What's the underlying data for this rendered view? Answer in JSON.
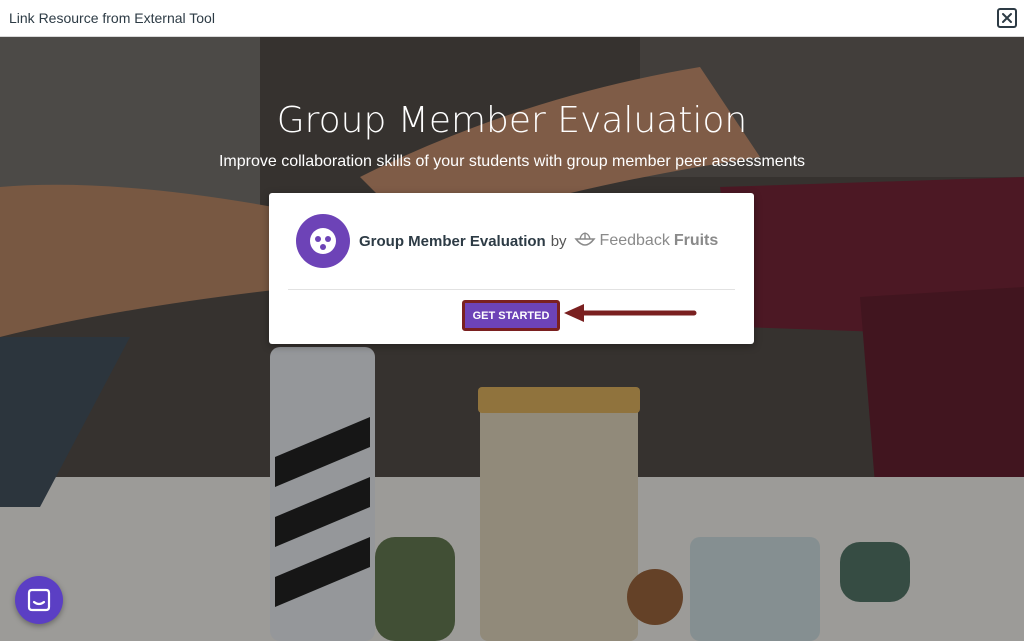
{
  "window": {
    "title": "Link Resource from External Tool",
    "close_icon": "close-icon"
  },
  "hero": {
    "title": "Group Member Evaluation",
    "subtitle": "Improve collaboration skills of your students with group member peer assessments"
  },
  "card": {
    "product_name": "Group Member Evaluation",
    "by_label": "by",
    "brand_light": "Feedback",
    "brand_bold": "Fruits",
    "cta_label": "GET STARTED",
    "logo_icon": "group-dots-icon",
    "brand_icon": "fruit-logo-icon"
  },
  "annotation": {
    "arrow_icon": "arrow-left-icon",
    "highlight_color": "#7a2020"
  },
  "chat": {
    "icon": "chat-icon"
  },
  "colors": {
    "accent": "#6d43b7",
    "annotation": "#7a2020"
  }
}
